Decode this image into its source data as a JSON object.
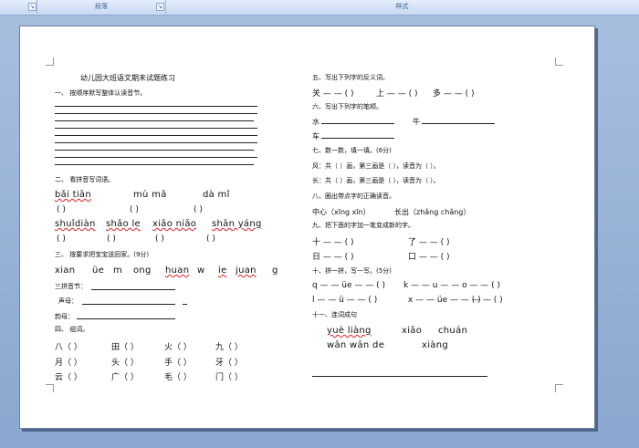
{
  "ribbon": {
    "group1": "段落",
    "group2": "样式"
  },
  "left": {
    "title": "幼儿园大班语文期末试题练习",
    "q1": "一、 按顺序默写整体认读音节。",
    "q2": "二、 看拼音写词语。",
    "q2_row1": [
      "bǎi tiān",
      "mù mǎ",
      "dà mǐ"
    ],
    "q2_row2": [
      "shuǐdiàn",
      "shǎo le",
      "xiǎo niǎo",
      "shān yáng"
    ],
    "paren": "(          )",
    "q3": "三、 按要求把宝宝送回家。(9分)",
    "q3_syllables": [
      "xian",
      "üe",
      "m",
      "ong",
      "huan",
      "w",
      "ie",
      "juan",
      "g"
    ],
    "q3_labels": [
      "三拼音节：",
      "声母：",
      "韵母："
    ],
    "q4": "四、 组词。",
    "q4_rows": [
      [
        "八（      ）",
        "田（      ）",
        "火（      ）",
        "九（      ）"
      ],
      [
        "月（      ）",
        "头（      ）",
        "手（      ）",
        "牙（      ）"
      ],
      [
        "云（      ）",
        "广（      ）",
        "毛（      ）",
        "门（      ）"
      ]
    ]
  },
  "right": {
    "q5": "五、写出下列字的反义词。",
    "q5_line": [
      "关 — — (        )",
      "上 — — (        )",
      "多 — — (        )"
    ],
    "q6": "六、写出下列字的笔顺。",
    "q6_chars": [
      "水",
      "牛",
      "车"
    ],
    "q7": "七、数一数，填一填。(6分)",
    "q7_line1": "风：共（      ）画，第三画是（      ），读音为（        ）。",
    "q7_line2": "长：共（      ）画，第三画是（      ），读音为（        ）。",
    "q8": "八、圈出带点字的正确读音。",
    "q8_a": "中心（xīng  xīn）",
    "q8_b": "长出（zhǎng  chǎng）",
    "q9": "九、把下面的字加一笔变成新的字。",
    "q9_rows": [
      [
        "十 — — (        )",
        "了 — — (        )"
      ],
      [
        "日 — — (        )",
        "口 — — (        )"
      ]
    ],
    "q10": "十、拼一拼，写一写。(5分)",
    "q10_row1": [
      "q — — üe — — (        )",
      "k — — u — — o — — (        )"
    ],
    "q10_row2": [
      "l — — ü — — (        )",
      "x — — üe — — (        )",
      "— — (        )"
    ],
    "q11": "十一、连词成句",
    "q11_row1": [
      "yuè liàng",
      "xiǎo",
      "chuán"
    ],
    "q11_row2": [
      "wān wān de",
      "xiàng"
    ]
  }
}
